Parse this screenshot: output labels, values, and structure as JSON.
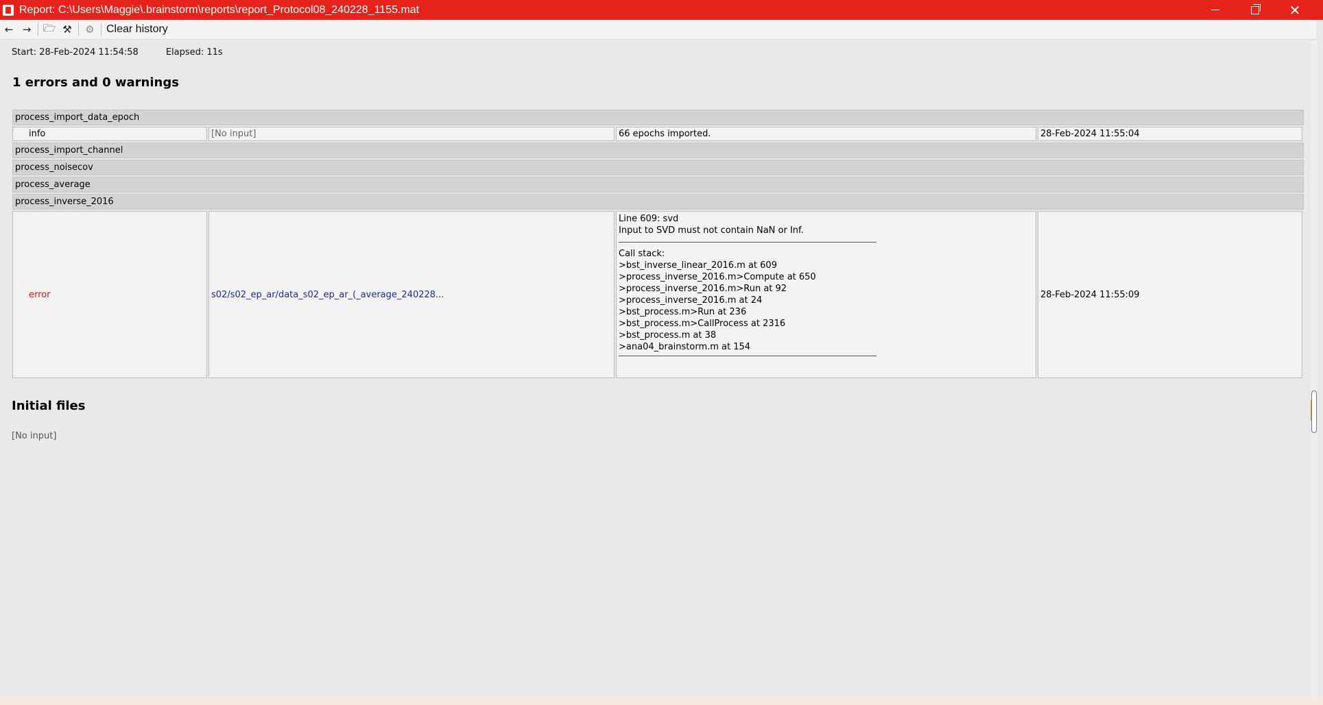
{
  "window": {
    "title": "Report: C:\\Users\\Maggie\\.brainstorm\\reports\\report_Protocol08_240228_1155.mat"
  },
  "toolbar": {
    "back_icon": "←",
    "forward_icon": "→",
    "open_icon": "🗁",
    "tool_icon": "⚒",
    "gear_icon": "⚙",
    "clear_history_label": "Clear history"
  },
  "meta": {
    "start": "Start: 28-Feb-2024 11:54:58",
    "elapsed": "Elapsed: 11s"
  },
  "summary": "1 errors and 0 warnings",
  "processes": [
    {
      "name": "process_import_data_epoch",
      "message": {
        "type": "info",
        "input": "[No input]",
        "text": "66 epochs imported.",
        "time": "28-Feb-2024 11:55:04"
      }
    },
    {
      "name": "process_import_channel"
    },
    {
      "name": "process_noisecov"
    },
    {
      "name": "process_average"
    },
    {
      "name": "process_inverse_2016",
      "message": {
        "type": "error",
        "input": "s02/s02_ep_ar/data_s02_ep_ar_(_average_240228...",
        "line1": "Line 609: svd",
        "line2": "Input to SVD must not contain NaN or Inf.",
        "callstack_label": "Call stack:",
        "stack": [
          ">bst_inverse_linear_2016.m at 609",
          ">process_inverse_2016.m>Compute at 650",
          ">process_inverse_2016.m>Run at 92",
          ">process_inverse_2016.m at 24",
          ">bst_process.m>Run at 236",
          ">bst_process.m>CallProcess at 2316",
          ">bst_process.m at 38",
          ">ana04_brainstorm.m at 154"
        ],
        "time": "28-Feb-2024 11:55:09"
      }
    }
  ],
  "initial_files": {
    "title": "Initial files",
    "value": "[No input]"
  }
}
